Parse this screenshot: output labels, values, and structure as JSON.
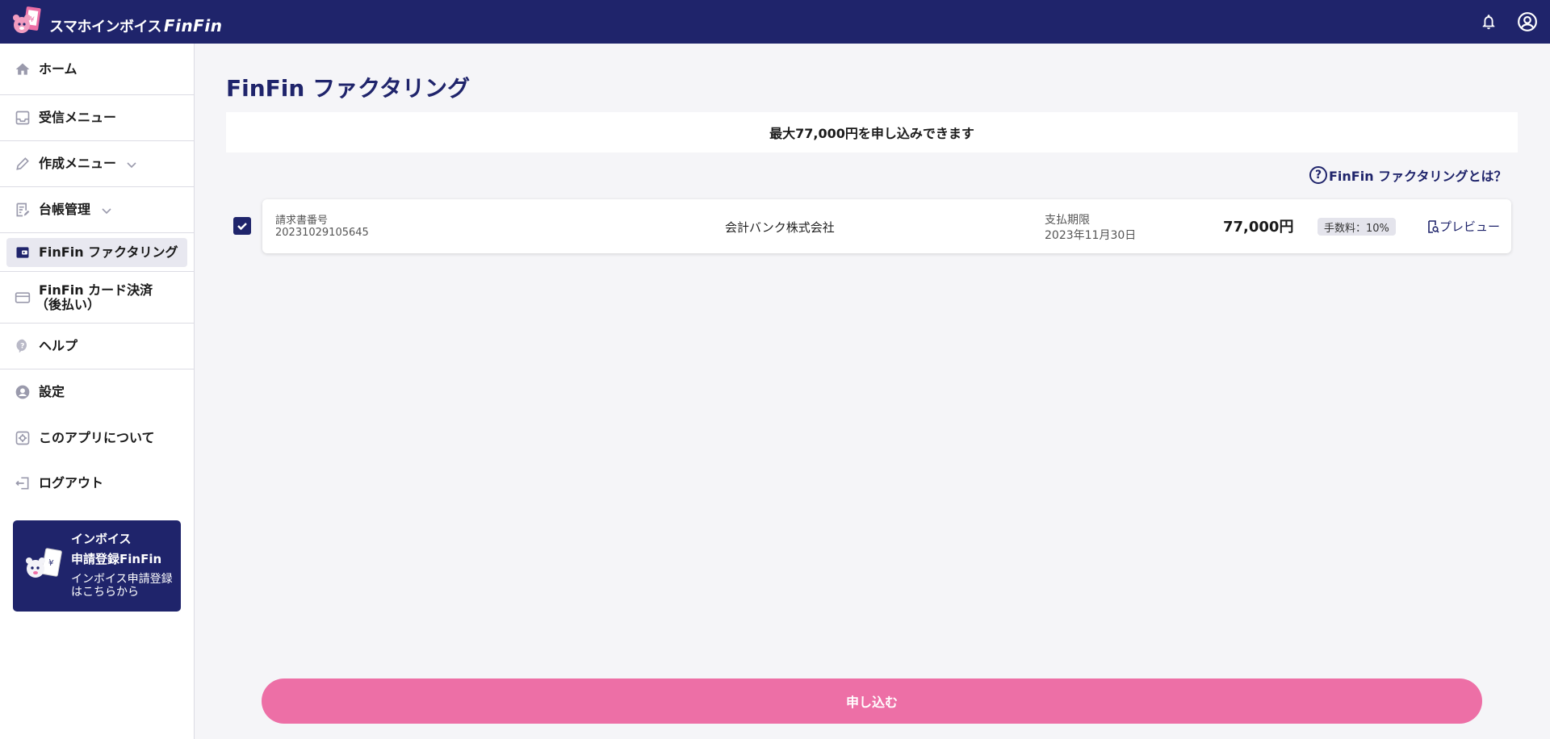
{
  "header": {
    "logo_text": "スマホインボイス",
    "logo_brand": "FinFin",
    "icons": [
      "bell-icon",
      "account-circle-icon"
    ],
    "color": "#1f246b"
  },
  "sidebar": {
    "items": [
      {
        "label": "ホーム",
        "icon": "home-icon"
      },
      {
        "label": "受信メニュー",
        "icon": "inbox-icon"
      },
      {
        "label": "作成メニュー",
        "icon": "pencil-icon"
      },
      {
        "label": "台帳管理",
        "icon": "ledger-icon"
      },
      {
        "label": "FinFin ファクタリング",
        "icon": "wallet-icon",
        "active": true
      },
      {
        "label": "FinFin カード決済",
        "label2": "（後払い）",
        "icon": "credit-card-icon"
      },
      {
        "label": "ヘルプ",
        "icon": "help-icon"
      },
      {
        "label": "設定",
        "icon": "user-circle-icon"
      },
      {
        "label": "このアプリについて",
        "icon": "app-info-icon"
      },
      {
        "label": "ログアウト",
        "icon": "logout-icon"
      }
    ],
    "promo": {
      "title1": "インボイス",
      "title2": "申請登録FinFin",
      "subtitle": "インボイス申請登録はこちらから"
    }
  },
  "main": {
    "title": "FinFin ファクタリング",
    "banner": "最大77,000円を申し込みできます",
    "about_link": "FinFin ファクタリングとは？",
    "invoice": {
      "checked": true,
      "number_label": "請求書番号",
      "number": "20231029105645",
      "company": "会計バンク株式会社",
      "due_label": "支払期限",
      "due_date": "2023年11月30日",
      "amount": "77,000円",
      "fee": "手数料：10%",
      "preview": "プレビュー"
    },
    "apply_button": "申し込む"
  },
  "colors": {
    "navy": "#1f246b",
    "pink": "#ed6fa6",
    "background": "#f5f5f8"
  }
}
